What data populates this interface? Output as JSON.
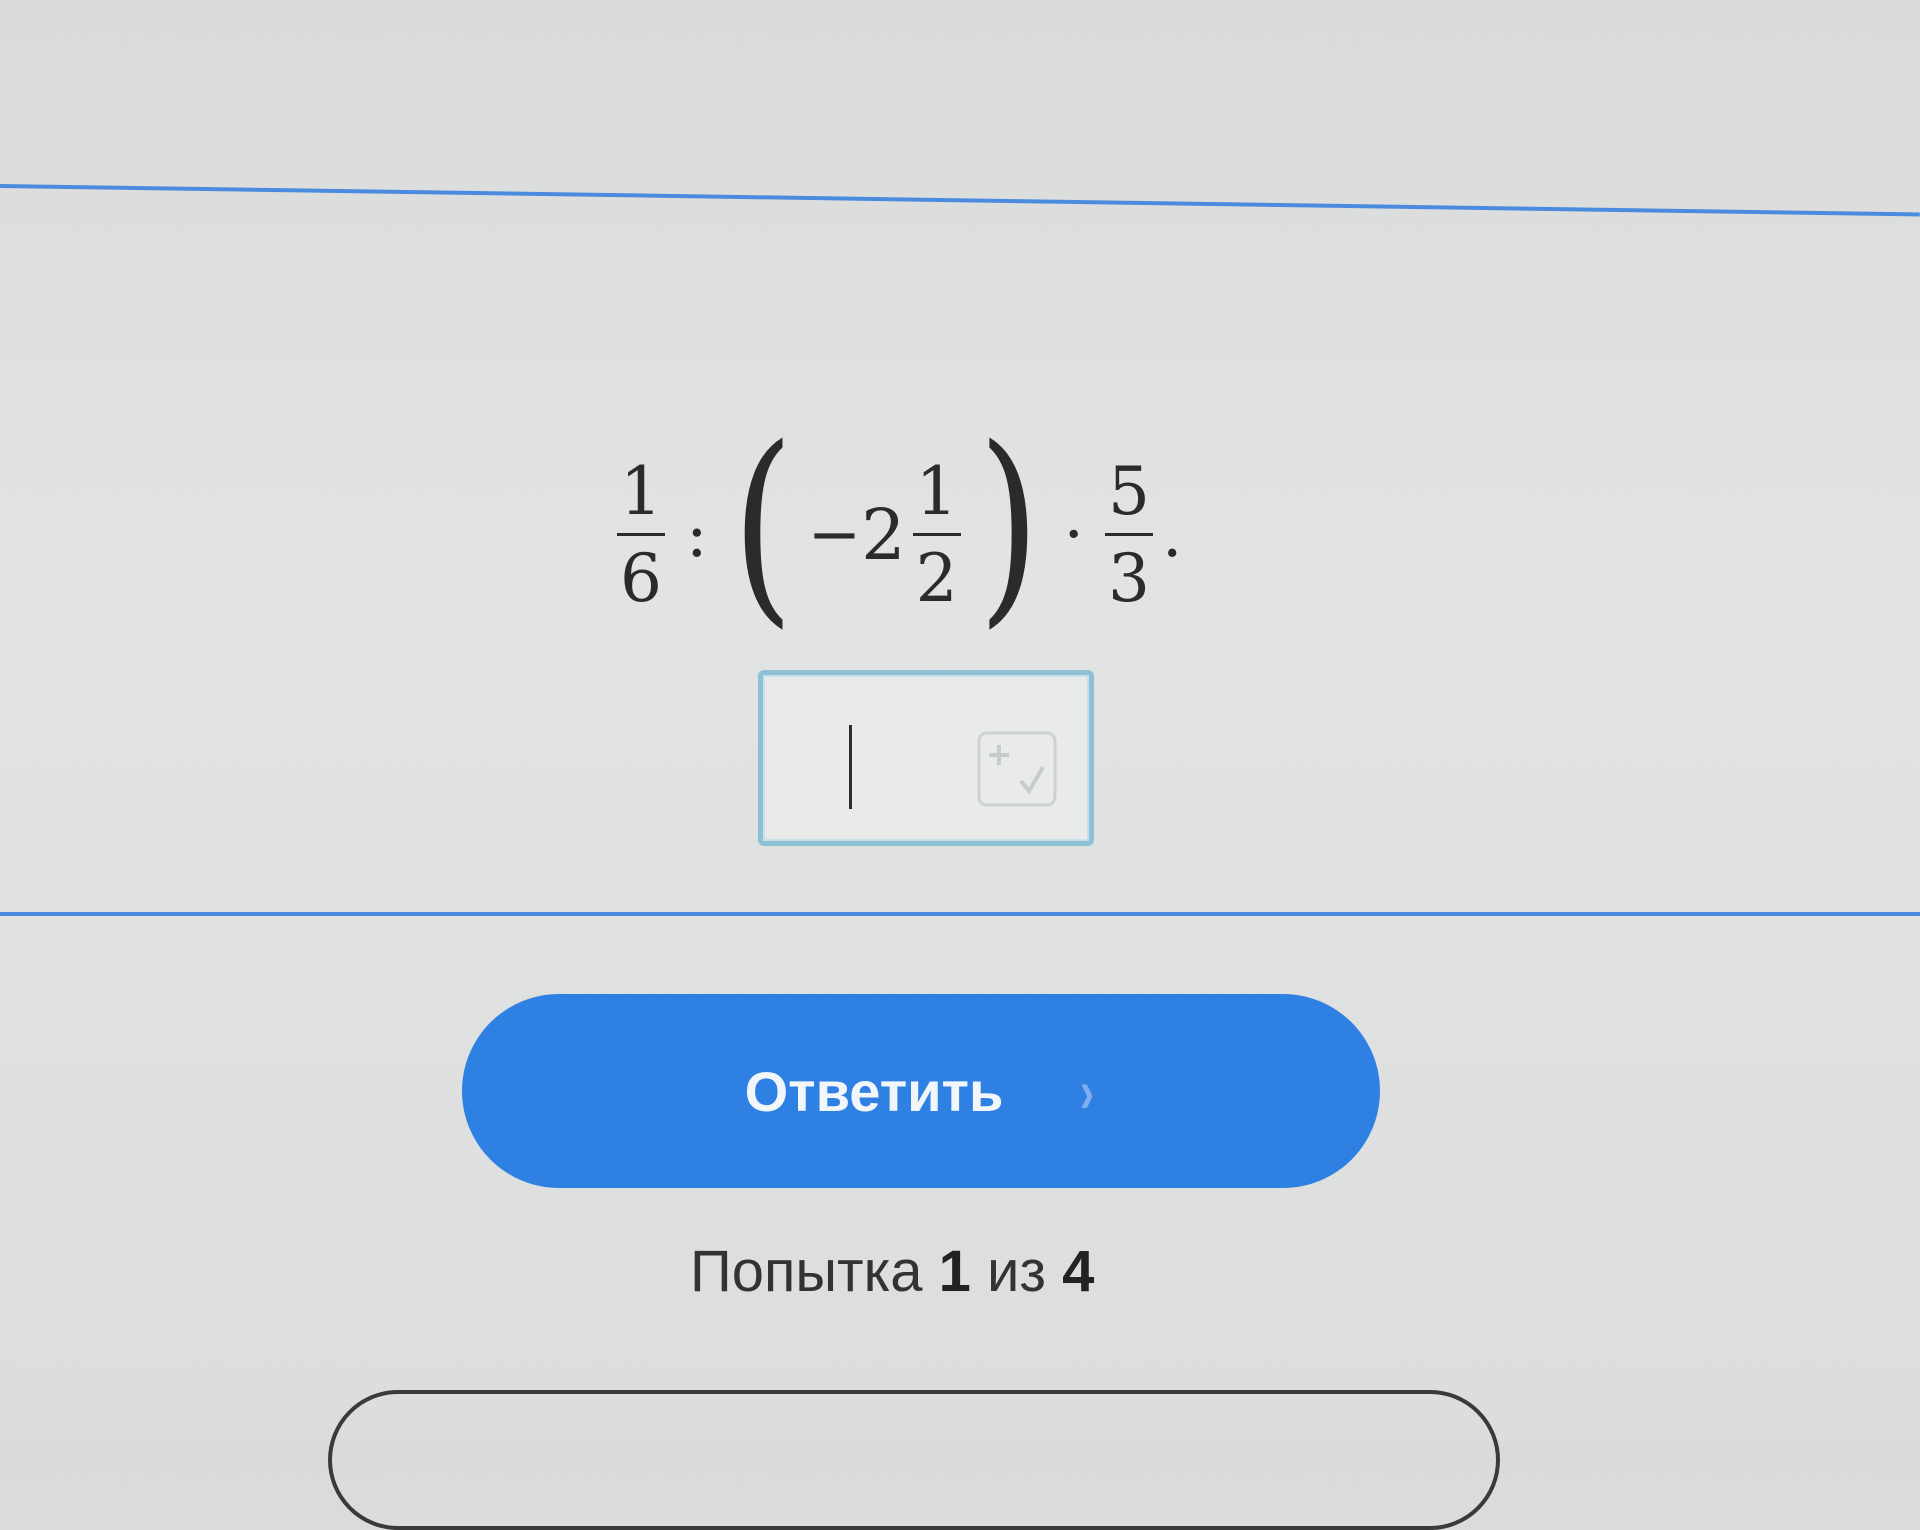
{
  "task": {
    "expression": {
      "fraction1": {
        "numerator": "1",
        "denominator": "6"
      },
      "divide": ":",
      "open_paren": "(",
      "minus": "−",
      "mixed": {
        "whole": "2",
        "numerator": "1",
        "denominator": "2"
      },
      "close_paren": ")",
      "multiply": "·",
      "fraction2": {
        "numerator": "5",
        "denominator": "3"
      },
      "end": "."
    }
  },
  "answer": {
    "value": ""
  },
  "submit": {
    "label": "Ответить",
    "chevron": "›"
  },
  "attempt": {
    "prefix": "Попытка",
    "current": "1",
    "middle": "из",
    "total": "4"
  },
  "icons": {
    "keypad": "plus-minus-keypad-icon",
    "submit_chevron": "chevron-right-icon"
  },
  "colors": {
    "accent": "#2f80e3",
    "divider": "#4a8be0",
    "input_border": "#8fc1d6"
  }
}
